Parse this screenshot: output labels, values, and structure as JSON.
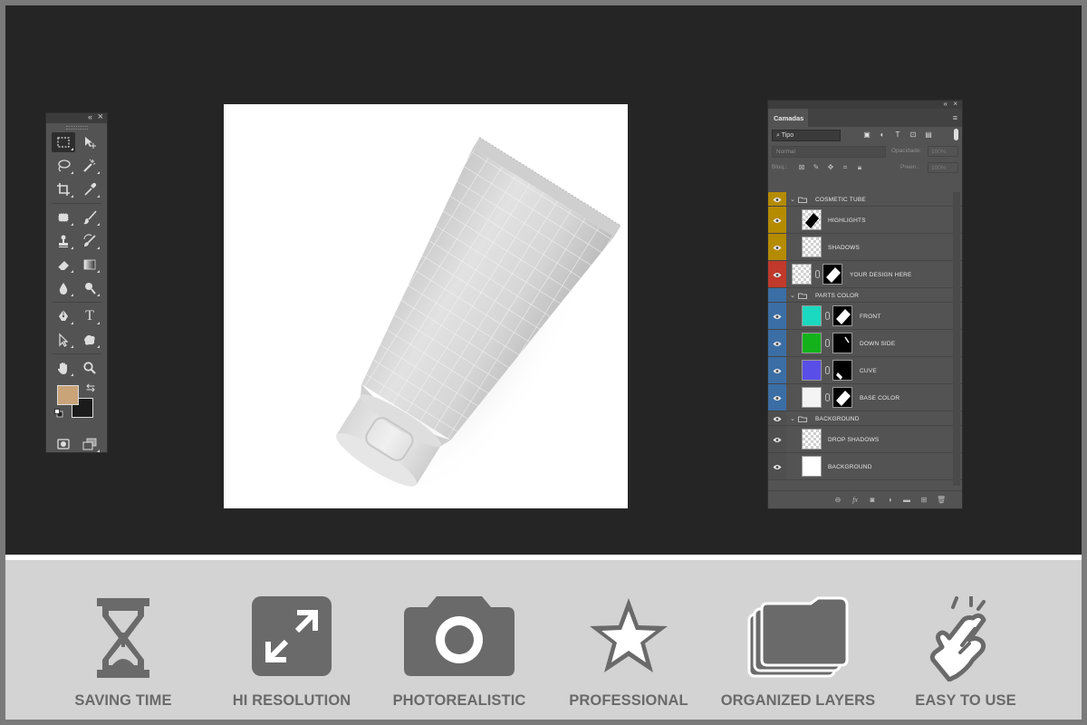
{
  "toolbox": {
    "collapse_glyph": "«",
    "close_glyph": "×",
    "tools": [
      [
        "marquee-tool",
        "move-tool"
      ],
      [
        "lasso-tool",
        "magic-wand-tool"
      ],
      [
        "crop-tool",
        "eyedropper-tool"
      ],
      [
        "healing-brush-tool",
        "brush-tool"
      ],
      [
        "clone-stamp-tool",
        "history-brush-tool"
      ],
      [
        "eraser-tool",
        "gradient-tool"
      ],
      [
        "blur-tool",
        "dodge-tool"
      ],
      [
        "pen-tool",
        "type-tool"
      ],
      [
        "path-selection-tool",
        "shape-tool"
      ],
      [
        "hand-tool",
        "zoom-tool"
      ]
    ],
    "type_glyph": "T",
    "foreground_color": "#c8a478",
    "background_color": "#1b1b1b"
  },
  "layers_panel": {
    "tab_label": "Camadas",
    "filter_label": "⌕ Tipo",
    "blend_mode": "Normal",
    "opacity_label": "Opacidade:",
    "opacity_value": "100%",
    "lock_label": "Bloq.:",
    "fill_label": "Preen.:",
    "fill_value": "100%",
    "layers": [
      {
        "kind": "group",
        "name": "COSMETIC TUBE",
        "tag": "#b58b00",
        "visible": true
      },
      {
        "kind": "item",
        "name": "HIGHLIGHTS",
        "tag": "#b58b00",
        "visible": true,
        "thumb": "checker"
      },
      {
        "kind": "item",
        "name": "SHADOWS",
        "tag": "#b58b00",
        "visible": true,
        "thumb": "checker"
      },
      {
        "kind": "item",
        "name": "YOUR DESIGN HERE",
        "tag": "#c0392b",
        "visible": true,
        "thumb": "smart",
        "mask": true
      },
      {
        "kind": "group",
        "name": "PARTS COLOR",
        "tag": "#3b6ea5",
        "visible": false
      },
      {
        "kind": "item",
        "name": "FRONT",
        "tag": "#3b6ea5",
        "visible": true,
        "thumb": "#1ad9c0",
        "mask": true
      },
      {
        "kind": "item",
        "name": "DOWN SIDE",
        "tag": "#3b6ea5",
        "visible": true,
        "thumb": "#13b21b",
        "mask": true
      },
      {
        "kind": "item",
        "name": "CUVE",
        "tag": "#3b6ea5",
        "visible": true,
        "thumb": "#5a4ee8",
        "mask": true
      },
      {
        "kind": "item",
        "name": "BASE COLOR",
        "tag": "#3b6ea5",
        "visible": true,
        "thumb": "#f4f4f4",
        "mask": true
      },
      {
        "kind": "group",
        "name": "BACKGROUND",
        "tag": "#4f4f4f",
        "visible": true
      },
      {
        "kind": "item",
        "name": "DROP SHADOWS",
        "tag": "#4f4f4f",
        "visible": true,
        "thumb": "checker"
      },
      {
        "kind": "item",
        "name": "BACKGROUND",
        "tag": "#4f4f4f",
        "visible": true,
        "thumb": "#ffffff"
      }
    ]
  },
  "features": [
    {
      "label": "SAVING TIME",
      "icon": "hourglass-icon"
    },
    {
      "label": "HI RESOLUTION",
      "icon": "expand-arrows-icon"
    },
    {
      "label": "PHOTOREALISTIC",
      "icon": "camera-icon"
    },
    {
      "label": "PROFESSIONAL",
      "icon": "star-icon"
    },
    {
      "label": "ORGANIZED LAYERS",
      "icon": "stacked-folders-icon"
    },
    {
      "label": "EASY TO USE",
      "icon": "tap-hand-icon"
    }
  ],
  "colors": {
    "workspace": "#252525",
    "panel": "#535353",
    "feature_strip": "#d3d3d3",
    "feature_gray": "#6a6a6a"
  }
}
